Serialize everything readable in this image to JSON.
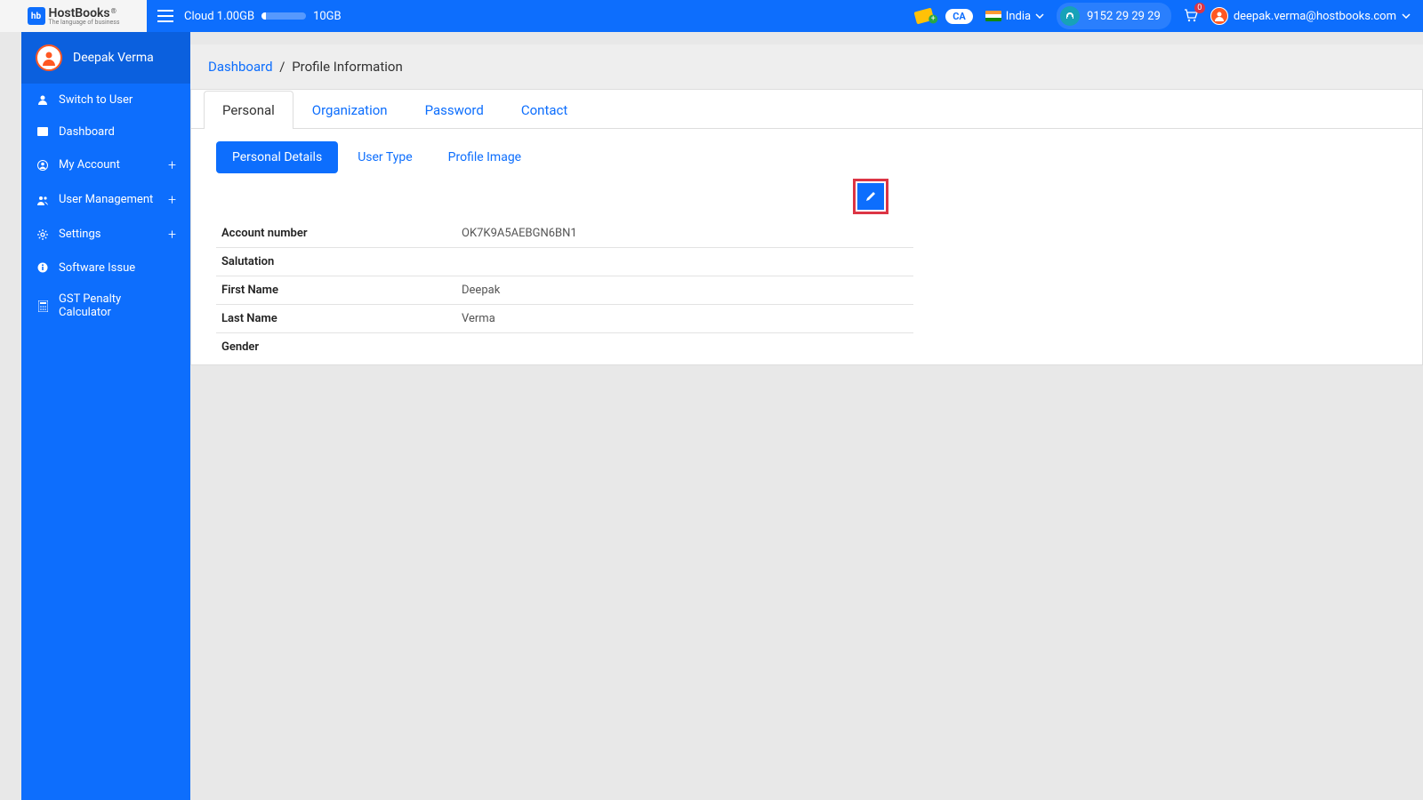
{
  "brand": {
    "logo_tile": "hb",
    "name": "HostBooks",
    "tagline": "The language of business",
    "reg_mark": "®"
  },
  "topbar": {
    "cloud_used": "Cloud 1.00GB",
    "cloud_total": "10GB",
    "country": "India",
    "phone": "9152 29 29 29",
    "cart_count": "0",
    "user_email": "deepak.verma@hostbooks.com",
    "ca_label": "CA"
  },
  "sidebar": {
    "user_name": "Deepak Verma",
    "items": [
      {
        "label": "Switch to User",
        "expandable": false
      },
      {
        "label": "Dashboard",
        "expandable": false
      },
      {
        "label": "My Account",
        "expandable": true
      },
      {
        "label": "User Management",
        "expandable": true
      },
      {
        "label": "Settings",
        "expandable": true
      },
      {
        "label": "Software Issue",
        "expandable": false
      },
      {
        "label": "GST Penalty Calculator",
        "expandable": false
      }
    ],
    "plus": "+"
  },
  "breadcrumb": {
    "root": "Dashboard",
    "sep": "/",
    "current": "Profile Information"
  },
  "tabs_primary": [
    {
      "label": "Personal",
      "active": true
    },
    {
      "label": "Organization",
      "active": false
    },
    {
      "label": "Password",
      "active": false
    },
    {
      "label": "Contact",
      "active": false
    }
  ],
  "tabs_secondary": [
    {
      "label": "Personal Details",
      "active": true
    },
    {
      "label": "User Type",
      "active": false
    },
    {
      "label": "Profile Image",
      "active": false
    }
  ],
  "details": [
    {
      "label": "Account number",
      "value": "OK7K9A5AEBGN6BN1"
    },
    {
      "label": "Salutation",
      "value": ""
    },
    {
      "label": "First Name",
      "value": "Deepak"
    },
    {
      "label": "Last Name",
      "value": "Verma"
    },
    {
      "label": "Gender",
      "value": ""
    }
  ]
}
